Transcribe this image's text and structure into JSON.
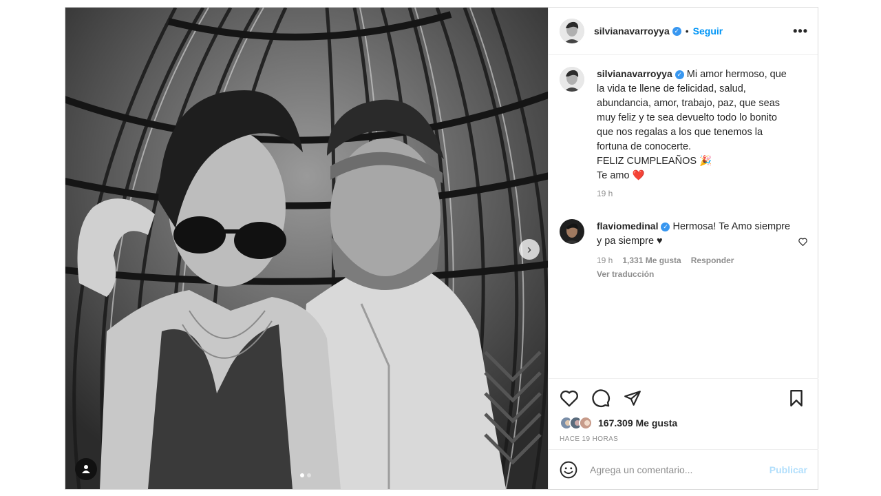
{
  "post": {
    "author": {
      "username": "silvianavarroyya",
      "verified": true,
      "follow_label": "Seguir",
      "separator": "•"
    },
    "more_icon": "more-horizontal-icon",
    "media": {
      "slide_index": 1,
      "slide_count": 2,
      "next_icon": "chevron-right-icon",
      "tag_icon": "user-tag-icon"
    },
    "caption": {
      "username": "silvianavarroyya",
      "text": "Mi amor hermoso, que la vida te llene de felicidad, salud, abundancia, amor, trabajo, paz, que seas muy feliz y te sea devuelto todo lo bonito que nos regalas a los que tenemos la fortuna de conocerte.",
      "line2": "FELIZ CUMPLEAÑOS 🎉",
      "line3": "Te amo ❤️",
      "time": "19 h"
    },
    "comments": [
      {
        "username": "flaviomedinal",
        "verified": true,
        "text": "Hermosa! Te Amo siempre y pa siempre ♥",
        "time": "19 h",
        "likes": "1,331 Me gusta",
        "reply_label": "Responder",
        "translate_label": "Ver traducción"
      }
    ],
    "actions": {
      "like_icon": "heart-icon",
      "comment_icon": "comment-bubble-icon",
      "share_icon": "send-paper-plane-icon",
      "save_icon": "bookmark-icon"
    },
    "likes_text": "167.309 Me gusta",
    "posted_ago": "HACE 19 HORAS",
    "comment_box": {
      "emoji_icon": "smiley-icon",
      "placeholder": "Agrega un comentario...",
      "publish_label": "Publicar"
    },
    "colors": {
      "accent": "#0095f6",
      "verified": "#3897f0",
      "publish_disabled": "#b2dffc",
      "muted": "#8e8e8e"
    }
  }
}
